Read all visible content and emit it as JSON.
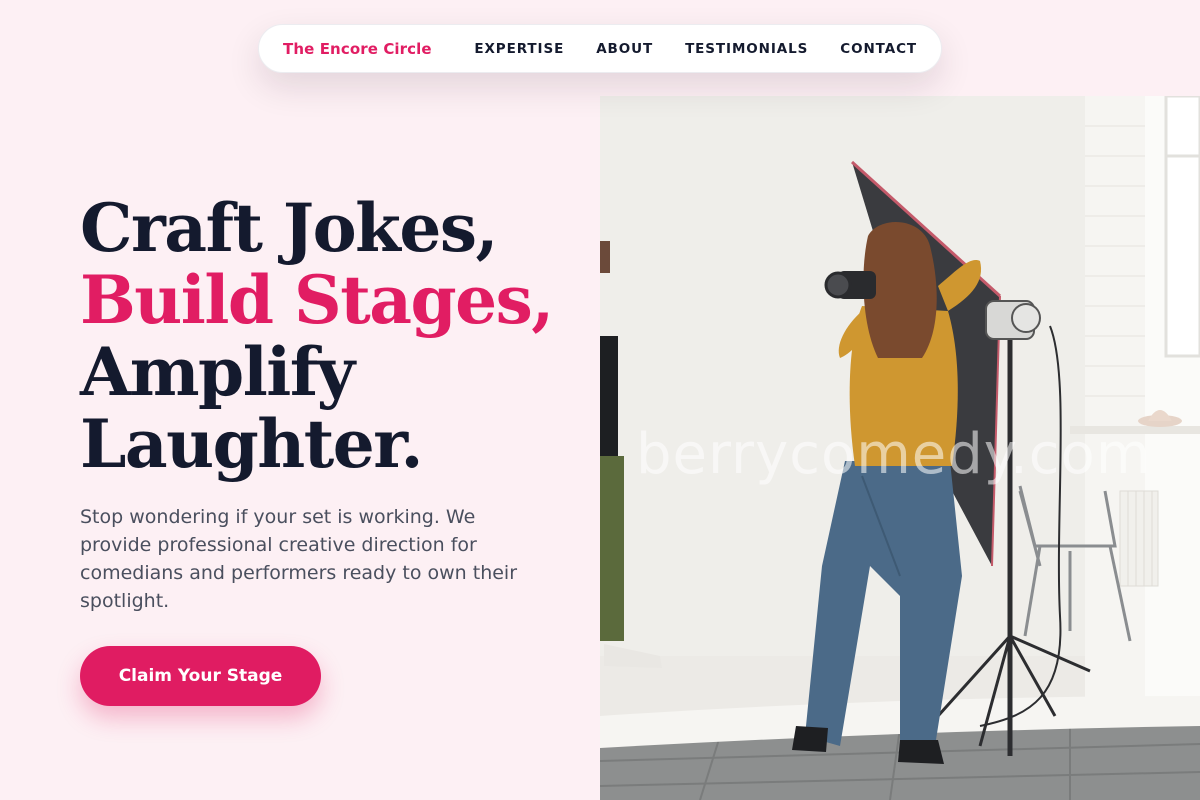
{
  "nav": {
    "brand": "The Encore Circle",
    "links": [
      "EXPERTISE",
      "ABOUT",
      "TESTIMONIALS",
      "CONTACT"
    ]
  },
  "hero": {
    "headline_line1": "Craft Jokes,",
    "headline_line2": "Build Stages,",
    "headline_line3": "Amplify",
    "headline_line4": "Laughter.",
    "description": "Stop wondering if your set is working. We provide professional creative direction for comedians and performers ready to own their spotlight.",
    "cta_label": "Claim Your Stage"
  },
  "photo": {
    "watermark": "berrycomedy.com"
  },
  "colors": {
    "accent": "#e11d63",
    "background": "#fdf0f4",
    "heading": "#141a2e"
  }
}
